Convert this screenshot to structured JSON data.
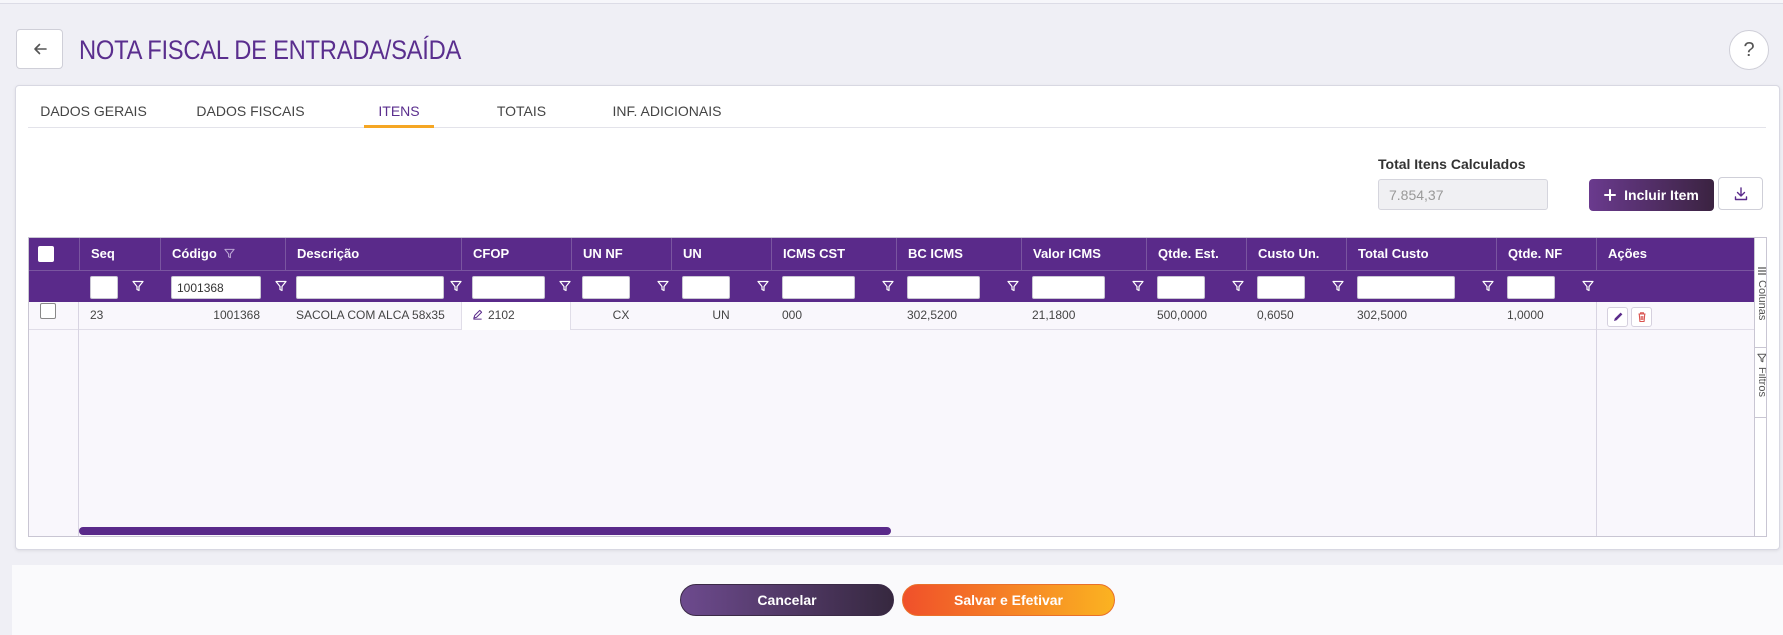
{
  "page": {
    "title": "NOTA FISCAL DE ENTRADA/SAÍDA",
    "help": "?"
  },
  "tabs": [
    {
      "label": "DADOS GERAIS"
    },
    {
      "label": "DADOS FISCAIS"
    },
    {
      "label": "ITENS"
    },
    {
      "label": "TOTAIS"
    },
    {
      "label": "INF. ADICIONAIS"
    }
  ],
  "active_tab": "ITENS",
  "totals": {
    "label": "Total Itens Calculados",
    "value": "7.854,37"
  },
  "actions": {
    "incluir_label": "Incluir Item"
  },
  "grid": {
    "columns": [
      "Seq",
      "Código",
      "Descrição",
      "CFOP",
      "UN NF",
      "UN",
      "ICMS CST",
      "BC ICMS",
      "Valor ICMS",
      "Qtde. Est.",
      "Custo Un.",
      "Total Custo",
      "Qtde. NF",
      "Ações"
    ],
    "filters": {
      "codigo": "1001368"
    },
    "rows": [
      {
        "seq": "23",
        "codigo": "1001368",
        "descricao": "SACOLA COM ALCA 58x35",
        "cfop": "2102",
        "un_nf": "CX",
        "un": "UN",
        "icms_cst": "000",
        "bc_icms": "302,5200",
        "valor_icms": "21,1800",
        "qtde_est": "500,0000",
        "custo_un": "0,6050",
        "total_custo": "302,5000",
        "qtde_nf": "1,0000"
      }
    ],
    "side_tabs": {
      "colunas": "Colunas",
      "filtros": "Filtros"
    }
  },
  "footer": {
    "cancel_label": "Cancelar",
    "save_label": "Salvar e Efetivar"
  },
  "colors": {
    "primary": "#5a2a8a",
    "accent": "#f5a623",
    "title": "#5a2e8e",
    "delete": "#d9534f"
  }
}
